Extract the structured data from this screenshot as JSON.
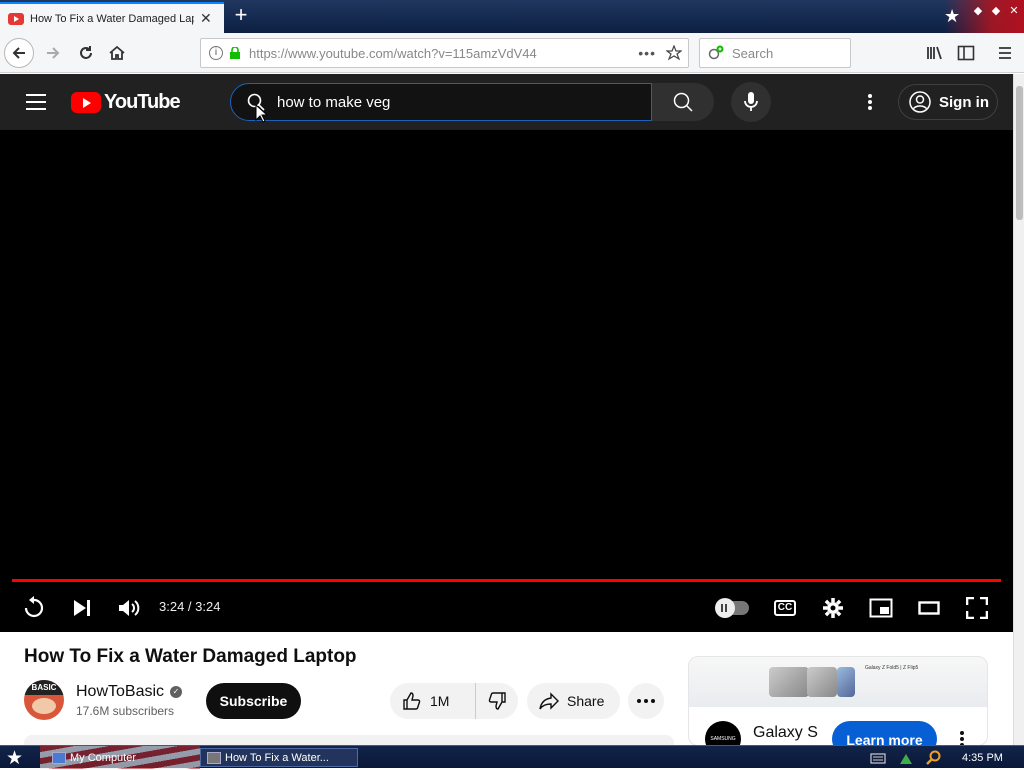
{
  "browser": {
    "tab_title": "How To Fix a Water Damaged Lap",
    "url": "https://www.youtube.com/watch?v=115amzVdV44",
    "search_placeholder": "Search"
  },
  "youtube": {
    "logo_text": "YouTube",
    "search_query": "how to make veg",
    "signin_label": "Sign in"
  },
  "player": {
    "time_display": "3:24 / 3:24",
    "progress_fraction": 1.0,
    "cc_label": "CC"
  },
  "video": {
    "title": "How To Fix a Water Damaged Laptop",
    "channel_name": "HowToBasic",
    "subscribers": "17.6M subscribers",
    "subscribe_label": "Subscribe",
    "like_count": "1M",
    "share_label": "Share",
    "avatar_text": "BASIC"
  },
  "ad": {
    "name": "Galaxy S",
    "cta": "Learn more",
    "banner_text": "Galaxy Z Fold5 | Z Flip5",
    "brand_mark": "SAMSUNG"
  },
  "taskbar": {
    "task_mycomputer": "My Computer",
    "task_active": "How To Fix a Water...",
    "clock": "4:35 PM"
  },
  "colors": {
    "youtube_red": "#ff0000",
    "youtube_header_bg": "#212121",
    "learn_more_blue": "#065fd4",
    "firefox_accent": "#0a84ff"
  }
}
